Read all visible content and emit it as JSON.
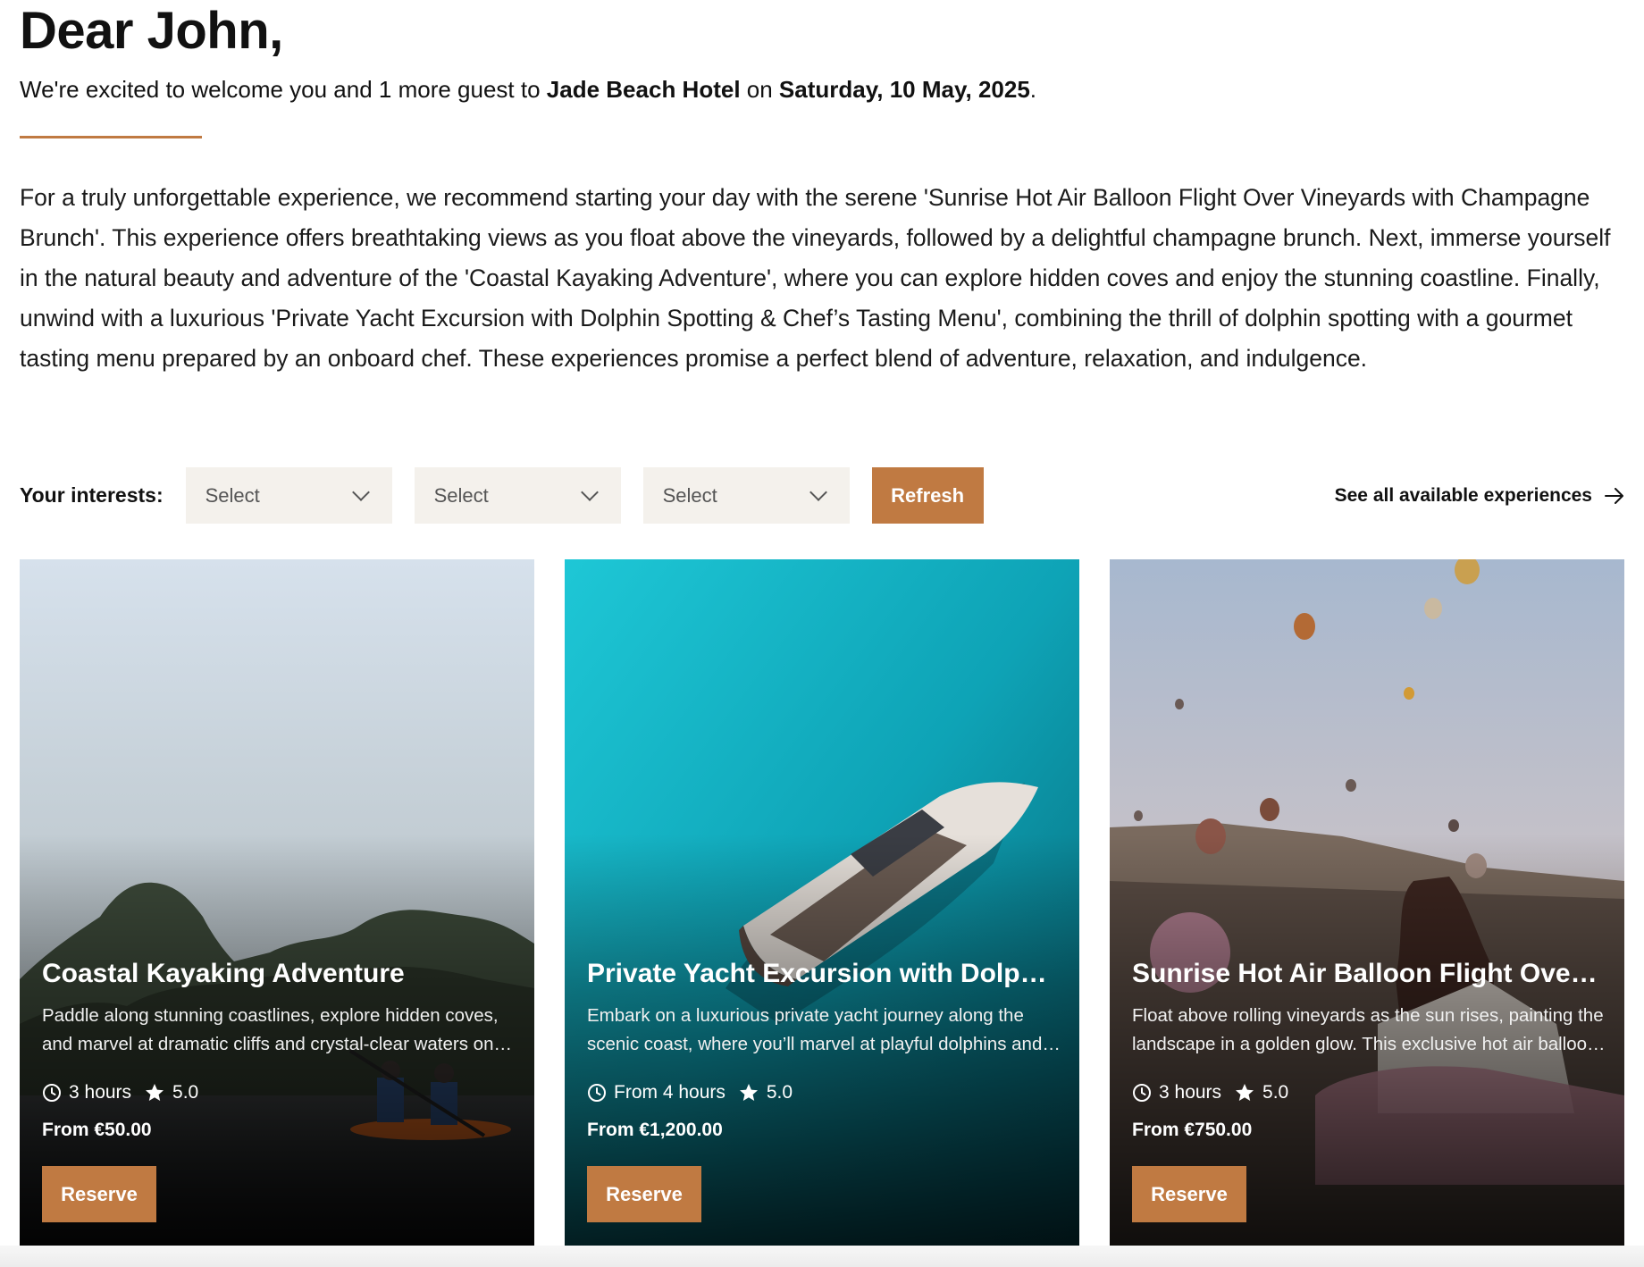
{
  "header": {
    "greeting": "Dear John,",
    "welcome_prefix": "We're excited to welcome you and 1 more guest to ",
    "hotel_name": "Jade Beach Hotel",
    "welcome_mid": " on ",
    "date": "Saturday, 10 May, 2025",
    "welcome_suffix": "."
  },
  "intro": "For a truly unforgettable experience, we recommend starting your day with the serene 'Sunrise Hot Air Balloon Flight Over Vineyards with Champagne Brunch'. This experience offers breathtaking views as you float above the vineyards, followed by a delightful champagne brunch. Next, immerse yourself in the natural beauty and adventure of the 'Coastal Kayaking Adventure', where you can explore hidden coves and enjoy the stunning coastline. Finally, unwind with a luxurious 'Private Yacht Excursion with Dolphin Spotting & Chef’s Tasting Menu', combining the thrill of dolphin spotting with a gourmet tasting menu prepared by an onboard chef. These experiences promise a perfect blend of adventure, relaxation, and indulgence.",
  "filters": {
    "label": "Your interests:",
    "selects": [
      {
        "value": "Select"
      },
      {
        "value": "Select"
      },
      {
        "value": "Select"
      }
    ],
    "refresh_label": "Refresh",
    "see_all_label": "See all available experiences"
  },
  "colors": {
    "accent": "#c07a42",
    "select_bg": "#f4f1ec"
  },
  "cards": [
    {
      "title": "Coastal Kayaking Adventure",
      "description": "Paddle along stunning coastlines, explore hidden coves, and marvel at dramatic cliffs and crystal-clear waters on this guided kayaking adventure.",
      "duration": "3 hours",
      "rating": "5.0",
      "price": "From €50.00",
      "reserve_label": "Reserve",
      "image": "kayak-cliffs-image"
    },
    {
      "title": "Private Yacht Excursion with Dolphin Spotting & Chef’s Tasting Menu",
      "description": "Embark on a luxurious private yacht journey along the scenic coast, where you’ll marvel at playful dolphins and enjoy a chef’s tasting menu.",
      "duration": "From 4 hours",
      "rating": "5.0",
      "price": "From €1,200.00",
      "reserve_label": "Reserve",
      "image": "yacht-aerial-image"
    },
    {
      "title": "Sunrise Hot Air Balloon Flight Over Vineyards with Champagne Brunch",
      "description": "Float above rolling vineyards as the sun rises, painting the landscape in a golden glow. This exclusive hot air balloon flight ends with a champagne brunch.",
      "duration": "3 hours",
      "rating": "5.0",
      "price": "From €750.00",
      "reserve_label": "Reserve",
      "image": "balloons-sunrise-image"
    }
  ]
}
